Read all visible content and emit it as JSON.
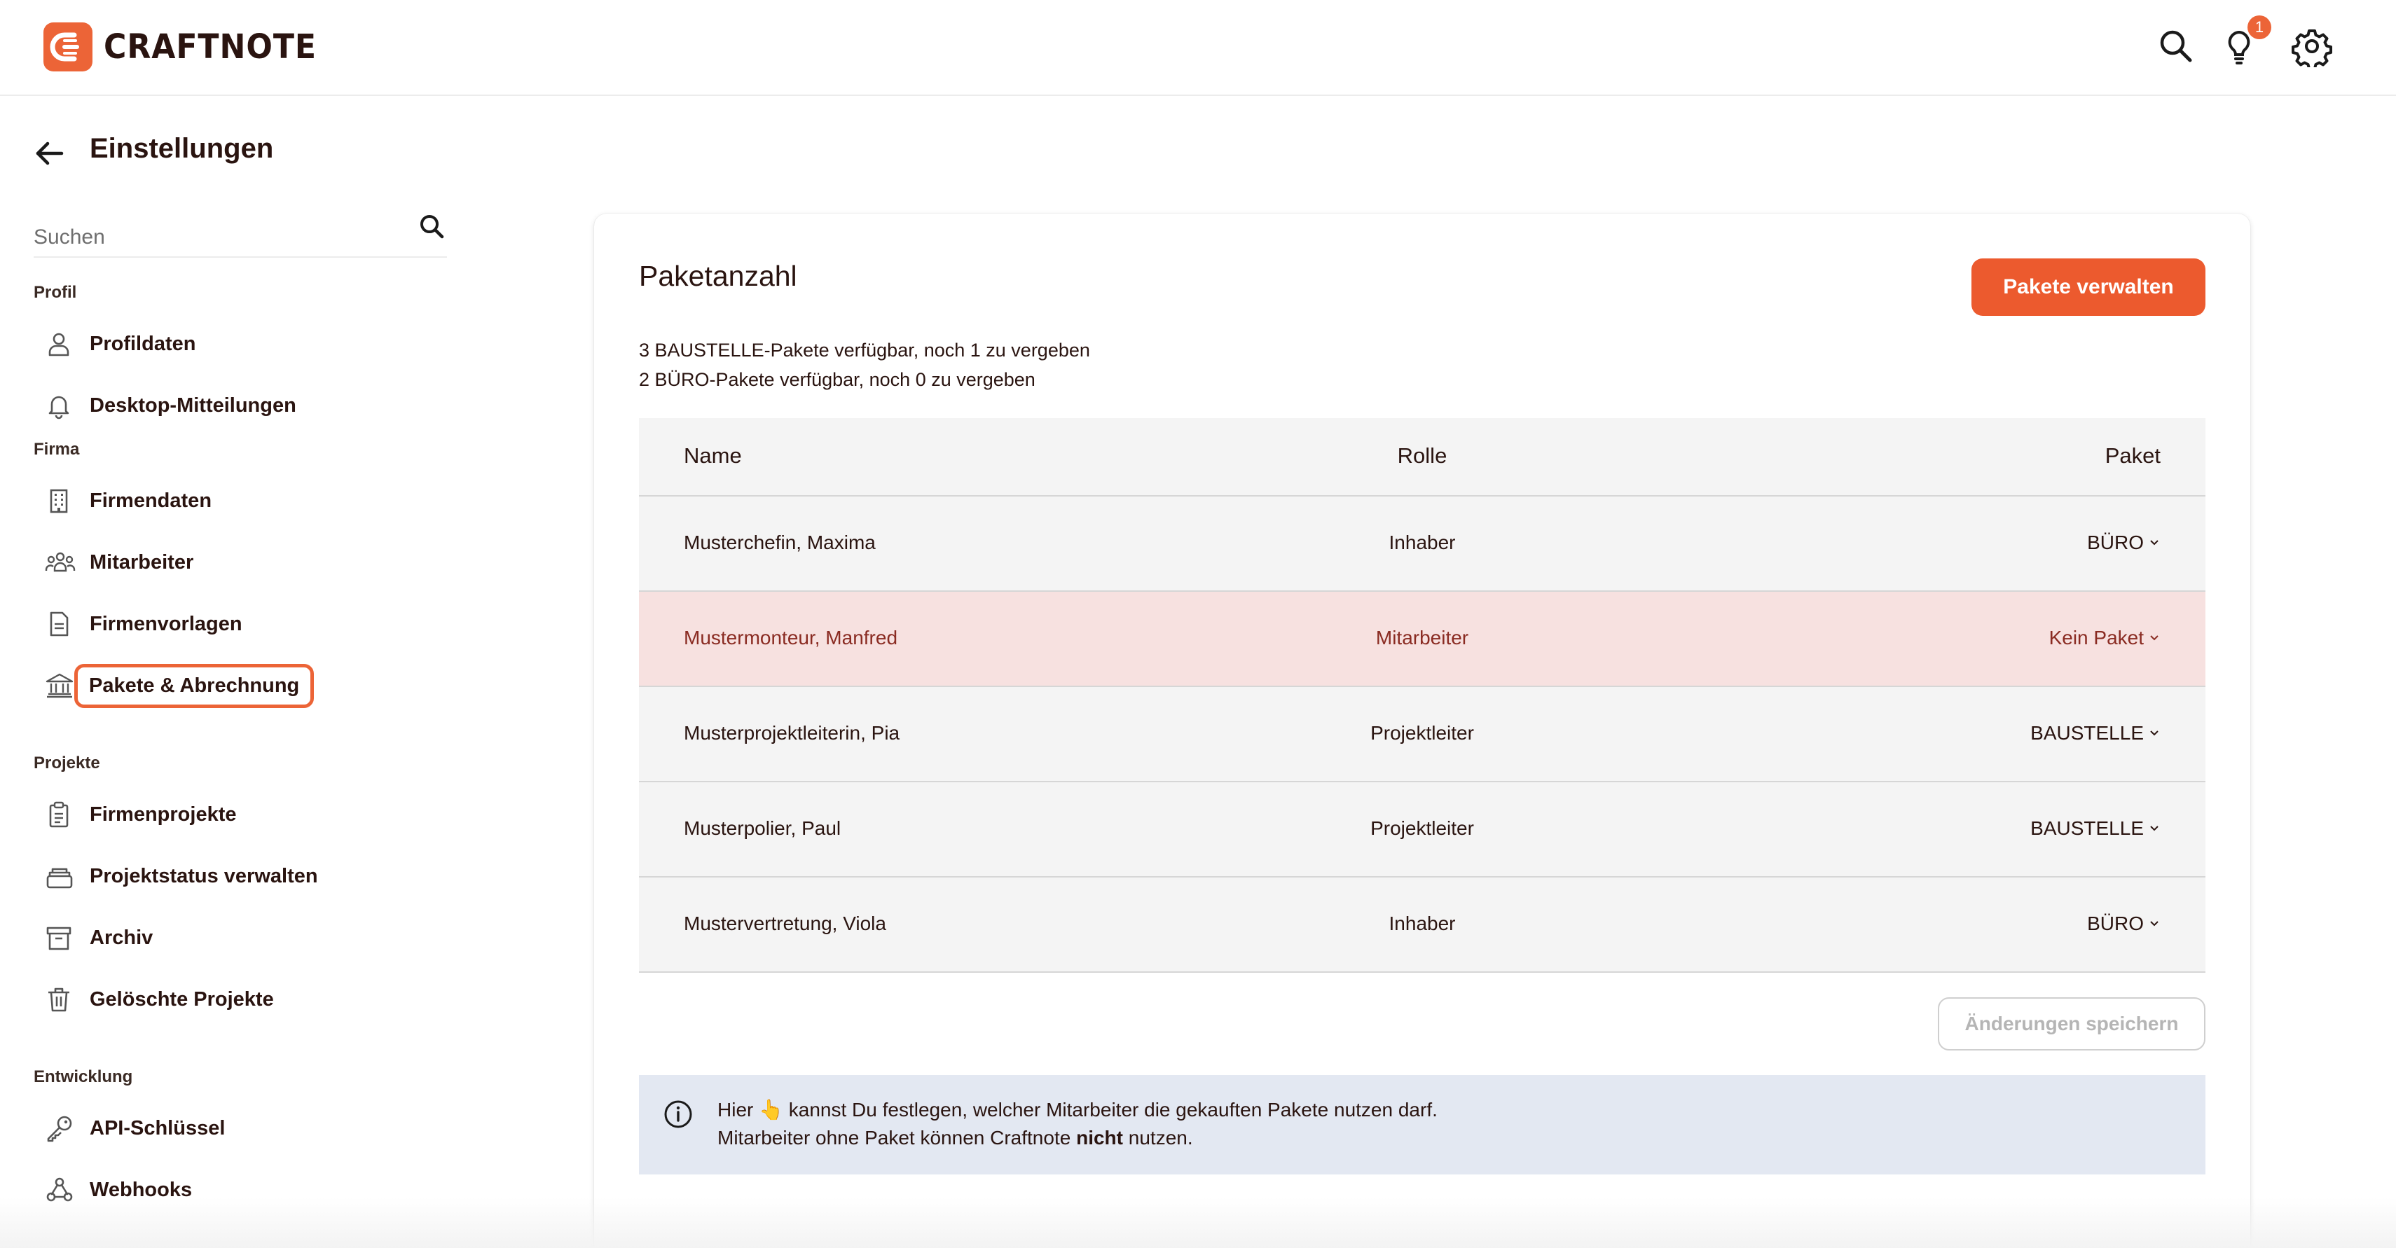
{
  "app": {
    "brand": "CRAFTNOTE",
    "notifications_count": "1"
  },
  "page": {
    "title": "Einstellungen"
  },
  "sidebar": {
    "search_placeholder": "Suchen",
    "sections": [
      {
        "title": "Profil",
        "items": [
          {
            "label": "Profildaten",
            "icon": "person-icon"
          },
          {
            "label": "Desktop-Mitteilungen",
            "icon": "bell-icon"
          }
        ]
      },
      {
        "title": "Firma",
        "items": [
          {
            "label": "Firmendaten",
            "icon": "building-icon"
          },
          {
            "label": "Mitarbeiter",
            "icon": "team-icon"
          },
          {
            "label": "Firmenvorlagen",
            "icon": "document-icon"
          },
          {
            "label": "Pakete & Abrechnung",
            "icon": "bank-icon",
            "active": true
          }
        ]
      },
      {
        "title": "Projekte",
        "items": [
          {
            "label": "Firmenprojekte",
            "icon": "clipboard-icon"
          },
          {
            "label": "Projektstatus verwalten",
            "icon": "stack-icon"
          },
          {
            "label": "Archiv",
            "icon": "archive-icon"
          },
          {
            "label": "Gelöschte Projekte",
            "icon": "trash-icon"
          }
        ]
      },
      {
        "title": "Entwicklung",
        "items": [
          {
            "label": "API-Schlüssel",
            "icon": "key-icon"
          },
          {
            "label": "Webhooks",
            "icon": "webhook-icon"
          }
        ]
      }
    ]
  },
  "card": {
    "title": "Paketanzahl",
    "manage_button": "Pakete verwalten",
    "availability": [
      "3 BAUSTELLE-Pakete verfügbar, noch 1 zu vergeben",
      "2 BÜRO-Pakete verfügbar, noch 0 zu vergeben"
    ],
    "table": {
      "headers": {
        "name": "Name",
        "role": "Rolle",
        "package": "Paket"
      },
      "rows": [
        {
          "name": "Musterchefin, Maxima",
          "role": "Inhaber",
          "package": "BÜRO",
          "warning": false
        },
        {
          "name": "Mustermonteur, Manfred",
          "role": "Mitarbeiter",
          "package": "Kein Paket",
          "warning": true
        },
        {
          "name": "Musterprojektleiterin, Pia",
          "role": "Projektleiter",
          "package": "BAUSTELLE",
          "warning": false
        },
        {
          "name": "Musterpolier, Paul",
          "role": "Projektleiter",
          "package": "BAUSTELLE",
          "warning": false
        },
        {
          "name": "Mustervertretung, Viola",
          "role": "Inhaber",
          "package": "BÜRO",
          "warning": false
        }
      ]
    },
    "save_button": "Änderungen speichern",
    "info": {
      "line1_before": "Hier",
      "line1_emoji": "👆",
      "line1_after": "kannst Du festlegen, welcher Mitarbeiter die gekauften Pakete nutzen darf.",
      "line2_before": "Mitarbeiter ohne Paket können Craftnote",
      "line2_bold": "nicht",
      "line2_after": "nutzen."
    }
  },
  "colors": {
    "accent": "#ec5a2e",
    "warning_row": "#f7e1e0",
    "info_bg": "#e3e8f2"
  }
}
